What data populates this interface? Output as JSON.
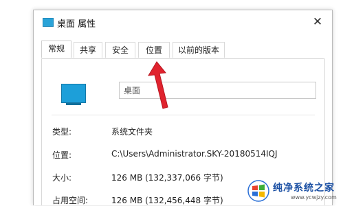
{
  "window": {
    "title": "桌面 属性",
    "close_glyph": "✕"
  },
  "tabs": [
    {
      "label": "常规",
      "active": true
    },
    {
      "label": "共享",
      "active": false
    },
    {
      "label": "安全",
      "active": false
    },
    {
      "label": "位置",
      "active": false
    },
    {
      "label": "以前的版本",
      "active": false
    }
  ],
  "general": {
    "name_value": "桌面",
    "properties": [
      {
        "label": "类型:",
        "value": "系统文件夹"
      },
      {
        "label": "位置:",
        "value": "C:\\Users\\Administrator.SKY-20180514IQJ"
      },
      {
        "label": "大小:",
        "value": "126 MB (132,337,066 字节)"
      },
      {
        "label": "占用空间:",
        "value": "126 MB (132,456,448 字节)"
      }
    ]
  },
  "annotation": {
    "arrow_color": "#e0232e",
    "target": "位置"
  },
  "watermark": {
    "title": "纯净系统之家",
    "url": "www.ycwjzy.com"
  },
  "colors": {
    "accent": "#1d9fd9",
    "watermark_blue": "#1a4fa3"
  }
}
